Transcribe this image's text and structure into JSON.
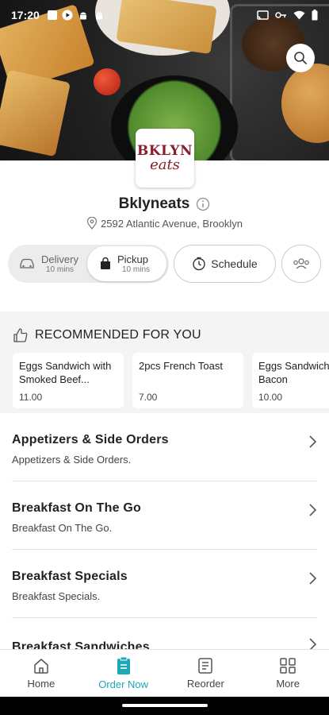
{
  "status_bar": {
    "time": "17:20",
    "left_icons": [
      "notification-square-icon",
      "play-icon",
      "android-icon",
      "android-icon"
    ],
    "right_icons": [
      "cast-icon",
      "key-icon",
      "wifi-icon",
      "battery-icon"
    ]
  },
  "restaurant": {
    "logo_line1": "BKLYN",
    "logo_line2": "eats",
    "name": "Bklyneats",
    "address": "2592 Atlantic Avenue, Brooklyn",
    "brand_color": "#8c1d2c"
  },
  "order_mode": {
    "delivery_label": "Delivery",
    "delivery_time": "10 mins",
    "pickup_label": "Pickup",
    "pickup_time": "10 mins",
    "selected": "Pickup",
    "schedule_label": "Schedule"
  },
  "recommended": {
    "heading": "RECOMMENDED FOR YOU",
    "items": [
      {
        "name": "Eggs Sandwich with Smoked Beef...",
        "price": "11.00"
      },
      {
        "name": "2pcs French Toast",
        "price": "7.00"
      },
      {
        "name": "Eggs Sandwich with Bacon",
        "price": "10.00"
      }
    ]
  },
  "categories": [
    {
      "title": "Appetizers & Side Orders",
      "desc": "Appetizers & Side Orders."
    },
    {
      "title": "Breakfast On The Go",
      "desc": "Breakfast On The Go."
    },
    {
      "title": "Breakfast Specials",
      "desc": "Breakfast Specials."
    },
    {
      "title": "Breakfast Sandwiches",
      "desc": ""
    }
  ],
  "bottom_nav": {
    "home": "Home",
    "order_now": "Order Now",
    "reorder": "Reorder",
    "more": "More",
    "active": "Order Now",
    "accent_color": "#1fa7b8"
  }
}
